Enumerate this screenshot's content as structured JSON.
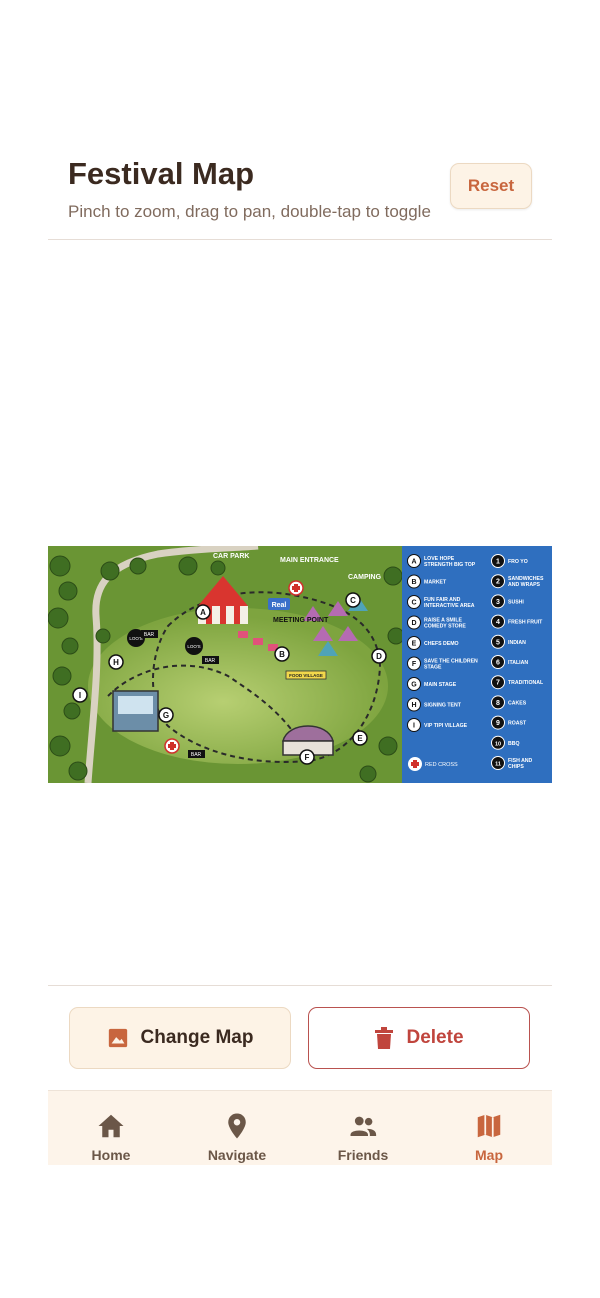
{
  "header": {
    "title": "Festival Map",
    "subtitle": "Pinch to zoom, drag to pan, double-tap to toggle",
    "reset_label": "Reset"
  },
  "map": {
    "labels": {
      "car_park": "CAR PARK",
      "main_entrance": "MAIN ENTRANCE",
      "camping": "CAMPING",
      "meeting_point": "MEETING POINT",
      "real": "Real",
      "food_village": "FOOD VILLAGE",
      "loos": "LOO'S",
      "bar": "BAR"
    },
    "legend_letters": [
      {
        "key": "A",
        "text": "LOVE HOPE STRENGTH BIG TOP"
      },
      {
        "key": "B",
        "text": "MARKET"
      },
      {
        "key": "C",
        "text": "FUN FAIR AND INTERACTIVE AREA"
      },
      {
        "key": "D",
        "text": "RAISE A SMILE COMEDY STORE"
      },
      {
        "key": "E",
        "text": "CHEFS DEMO"
      },
      {
        "key": "F",
        "text": "SAVE THE CHILDREN STAGE"
      },
      {
        "key": "G",
        "text": "MAIN STAGE"
      },
      {
        "key": "H",
        "text": "SIGNING TENT"
      },
      {
        "key": "I",
        "text": "VIP TIPI VILLAGE"
      }
    ],
    "red_cross": "RED CROSS",
    "legend_numbers": [
      {
        "key": "1",
        "text": "FRO YO"
      },
      {
        "key": "2",
        "text": "SANDWICHES AND WRAPS"
      },
      {
        "key": "3",
        "text": "SUSHI"
      },
      {
        "key": "4",
        "text": "FRESH FRUIT"
      },
      {
        "key": "5",
        "text": "INDIAN"
      },
      {
        "key": "6",
        "text": "ITALIAN"
      },
      {
        "key": "7",
        "text": "TRADITIONAL"
      },
      {
        "key": "8",
        "text": "CAKES"
      },
      {
        "key": "9",
        "text": "ROAST"
      },
      {
        "key": "10",
        "text": "BBQ"
      },
      {
        "key": "11",
        "text": "FISH AND CHIPS"
      }
    ]
  },
  "actions": {
    "change_map_label": "Change Map",
    "delete_label": "Delete"
  },
  "tabs": [
    {
      "label": "Home",
      "icon": "home-icon"
    },
    {
      "label": "Navigate",
      "icon": "location-pin-icon"
    },
    {
      "label": "Friends",
      "icon": "people-icon"
    },
    {
      "label": "Map",
      "icon": "map-icon",
      "active": true
    }
  ],
  "colors": {
    "accent": "#c8663e",
    "delete": "#c0453d",
    "legend_bg": "#2f6fbf",
    "grass": "#6f9a3a"
  }
}
